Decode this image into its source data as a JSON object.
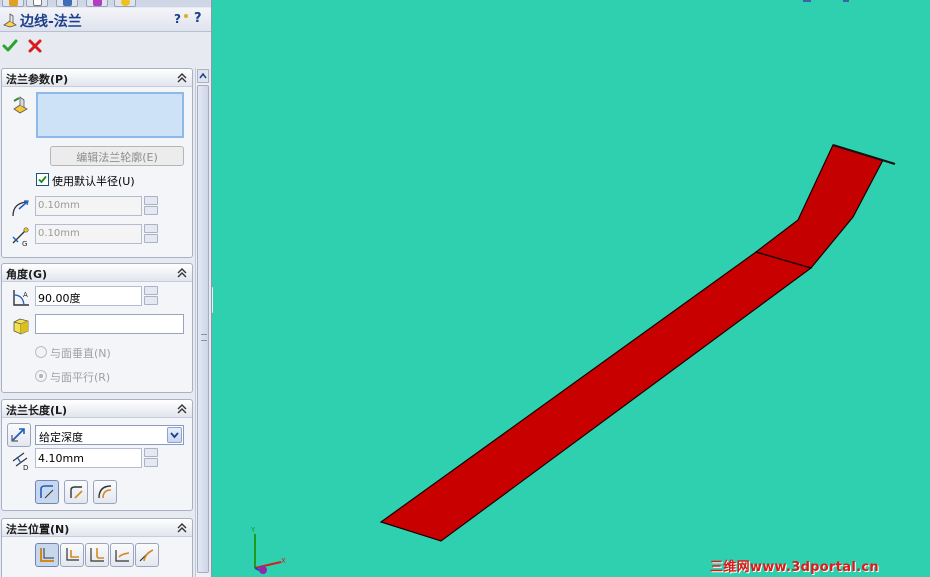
{
  "property_manager": {
    "title": "边线-法兰",
    "help_label": "?",
    "flange_params": {
      "header": "法兰参数(P)",
      "edit_profile_button": "编辑法兰轮廓(E)",
      "use_default_radius_label": "使用默认半径(U)",
      "use_default_radius_checked": true,
      "bend_radius": "0.10mm",
      "gap_distance": "0.10mm"
    },
    "angle": {
      "header": "角度(G)",
      "angle_value": "90.00度",
      "reference_face_value": "",
      "option_perpendicular": "与面垂直(N)",
      "option_parallel": "与面平行(R)",
      "selected_option": "parallel"
    },
    "flange_length": {
      "header": "法兰长度(L)",
      "end_condition": "给定深度",
      "length_value": "4.10mm"
    },
    "flange_position": {
      "header": "法兰位置(N)"
    }
  },
  "viewport": {
    "background_color": "#2fd0b0",
    "model_color": "#c80000",
    "watermark": "三维网www.3dportal.cn"
  }
}
